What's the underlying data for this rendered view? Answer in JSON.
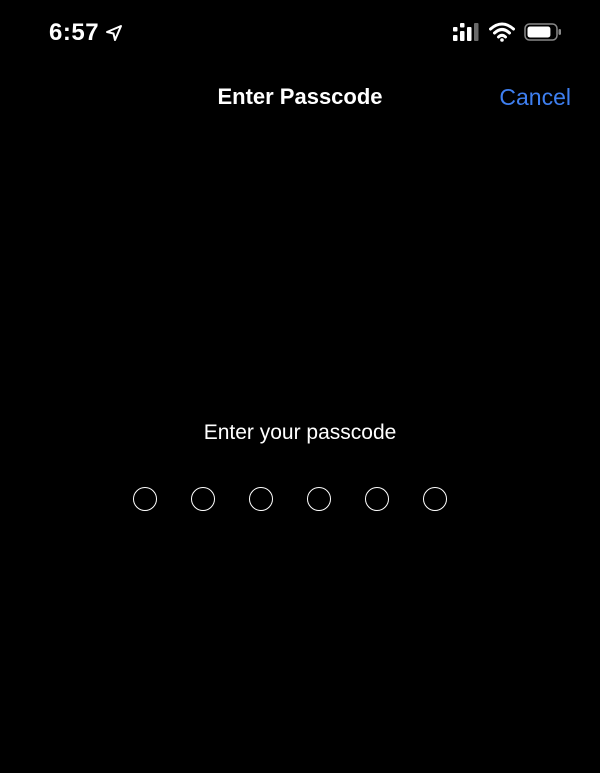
{
  "status_bar": {
    "time": "6:57",
    "icons": [
      "location-arrow-icon",
      "cellular-signal-icon",
      "wifi-icon",
      "battery-icon"
    ],
    "battery_level": 0.85
  },
  "nav": {
    "title": "Enter Passcode",
    "cancel_label": "Cancel"
  },
  "passcode": {
    "prompt": "Enter your passcode",
    "length": 6,
    "entered": 0
  },
  "colors": {
    "background": "#000000",
    "text": "#ffffff",
    "accent": "#3e7ff0"
  }
}
